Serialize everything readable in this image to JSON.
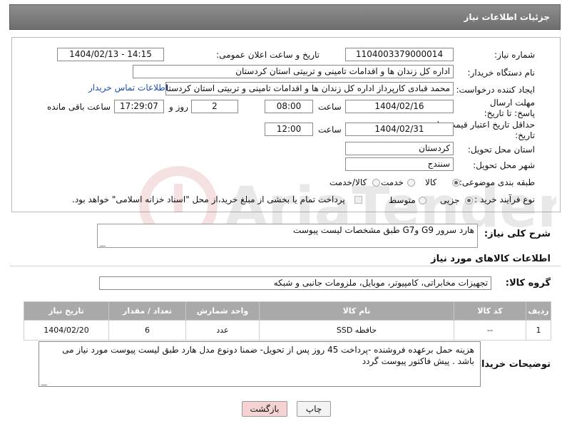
{
  "page": {
    "title": "جزئیات اطلاعات نیاز"
  },
  "fields": {
    "need_number_label": "شماره نیاز:",
    "need_number": "1104003379000014",
    "announce_label": "تاریخ و ساعت اعلان عمومی:",
    "announce_value": "1404/02/13 - 14:15",
    "buyer_org_label": "نام دستگاه خریدار:",
    "buyer_org": "اداره کل زندان ها و اقدامات تامینی و تربیتی استان کردستان",
    "creator_label": "ایجاد کننده درخواست:",
    "creator": "محمد  قبادی کارپرداز اداره کل زندان ها و اقدامات تامینی و تربیتی استان کردستا",
    "contact_link": "اطلاعات تماس خریدار",
    "deadline_label": "مهلت ارسال پاسخ: تا تاریخ:",
    "deadline_date": "1404/02/16",
    "time_word": "ساعت",
    "deadline_time": "08:00",
    "days_value": "2",
    "days_word": "روز و",
    "remaining_time": "17:29:07",
    "remaining_word": "ساعت باقی مانده",
    "price_validity_label": "حداقل تاریخ اعتبار قیمت: تا تاریخ:",
    "price_validity_date": "1404/02/31",
    "price_validity_time": "12:00",
    "province_label": "استان محل تحویل:",
    "province": "کردستان",
    "city_label": "شهر محل تحویل:",
    "city": "سنندج",
    "category_label": "طبقه بندی موضوعی:",
    "category_options": [
      "کالا",
      "خدمت",
      "کالا/خدمت"
    ],
    "purchase_type_label": "نوع فرآیند خرید :",
    "purchase_options": [
      "جزیی",
      "متوسط"
    ],
    "payment_note": "پرداخت تمام یا بخشی از مبلغ خرید،از محل \"اسناد خزانه اسلامی\" خواهد بود."
  },
  "description": {
    "label": "شرح کلی نیاز:",
    "value": "هارد سرور   G9 وG7  طبق مشخصات لیست پیوست"
  },
  "goods": {
    "section_title": "اطلاعات کالاهای مورد نیاز",
    "group_label": "گروه کالا:",
    "group_value": "تجهیزات مخابراتی، کامپیوتر، موبایل، ملزومات جانبی و شبکه",
    "columns": [
      "ردیف",
      "کد کالا",
      "نام کالا",
      "واحد شمارش",
      "تعداد / مقدار",
      "تاریخ نیاز"
    ],
    "rows": [
      {
        "row": "1",
        "code": "--",
        "name": "حافظه SSD",
        "unit": "عدد",
        "qty": "6",
        "date": "1404/02/20"
      }
    ]
  },
  "buyer_notes": {
    "label": "توضیحات خریدار:",
    "value": "هزینه حمل برعهده فروشنده -پرداخت   45 روز پس از تحویل- ضمنا  دونوع مدل هارد  طبق لیست پیوست  مورد نیاز می باشد . پیش فاکتور پیوست گردد"
  },
  "buttons": {
    "print": "چاپ",
    "back": "بازگشت"
  },
  "watermark": {
    "text": "AriaTender.net"
  },
  "colors": {
    "title_bg": "#7a7a7a",
    "link": "#1a4fb5",
    "table_header": "#a9a9a9",
    "back_button_bg": "#f6d3d3"
  }
}
